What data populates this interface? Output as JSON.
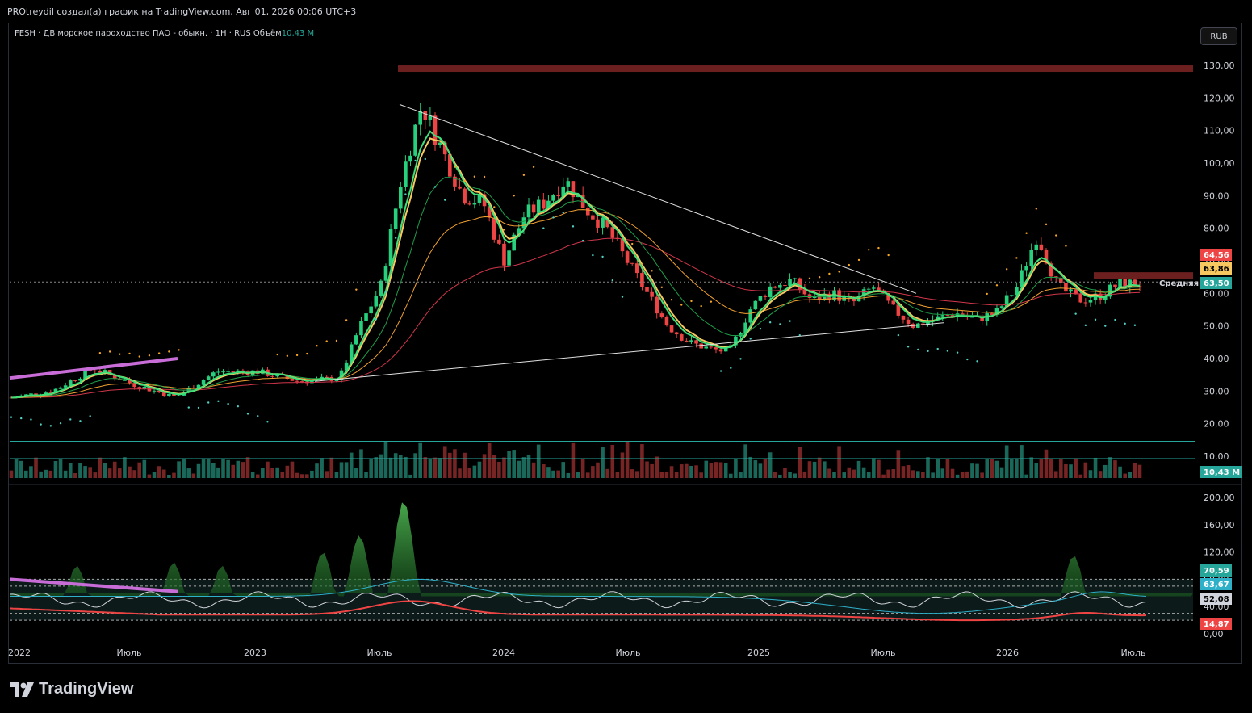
{
  "header": {
    "text": "PROtreydil создал(а) график на TradingView.com, Авг 01, 2026 00:06 UTC+3"
  },
  "legend": {
    "symbol": "FESH",
    "separator": "·",
    "name": "ДВ морское пароходство ПАО - обыкн.",
    "interval": "1H",
    "exchange": "RUS",
    "volume_label": "Объём",
    "volume_value": "10,43 M"
  },
  "currency_button": "RUB",
  "brand": "TradingView",
  "colors": {
    "up": "#26d07c",
    "down": "#ef4444",
    "accent_teal": "#26a69a",
    "resistance": "#6b1f1f",
    "trend": "#e0e0e0",
    "purple": "#c86dd7"
  },
  "chart_data": [
    {
      "type": "candlestick",
      "price_axis": {
        "min": 0,
        "max": 130,
        "ticks": [
          "130,00",
          "120,00",
          "110,00",
          "100,00",
          "90,00",
          "80,00",
          "70,00",
          "60,00",
          "50,00",
          "40,00",
          "30,00",
          "20,00",
          "10,00"
        ]
      },
      "time_axis": {
        "labels": [
          "2022",
          "Июль",
          "2023",
          "Июль",
          "2024",
          "Июль",
          "2025",
          "Июль",
          "2026",
          "Июль"
        ]
      },
      "series": [
        {
          "name": "price",
          "x": [
            "2022-01",
            "2022-03",
            "2022-05",
            "2022-07",
            "2022-09",
            "2022-11",
            "2023-01",
            "2023-03",
            "2023-05",
            "2023-06",
            "2023-07",
            "2023-08",
            "2023-09",
            "2023-10",
            "2023-11",
            "2023-12",
            "2024-01",
            "2024-02",
            "2024-03",
            "2024-04",
            "2024-05",
            "2024-06",
            "2024-07",
            "2024-08",
            "2024-09",
            "2024-10",
            "2024-11",
            "2024-12",
            "2025-01",
            "2025-02",
            "2025-03",
            "2025-04",
            "2025-05",
            "2025-06",
            "2025-07",
            "2025-08",
            "2025-09",
            "2025-10",
            "2025-11",
            "2025-12",
            "2026-01",
            "2026-02",
            "2026-03",
            "2026-04",
            "2026-05",
            "2026-06",
            "2026-07"
          ],
          "y": [
            28,
            30,
            37,
            32,
            28,
            36,
            36,
            33,
            34,
            50,
            62,
            95,
            118,
            104,
            90,
            88,
            70,
            84,
            88,
            95,
            86,
            80,
            70,
            60,
            50,
            45,
            43,
            42,
            55,
            62,
            64,
            58,
            60,
            57,
            62,
            55,
            50,
            52,
            54,
            52,
            54,
            62,
            78,
            62,
            58,
            59,
            63
          ]
        },
        {
          "name": "resistance",
          "y": 129
        },
        {
          "name": "zone",
          "y": [
            64.5,
            66.5
          ]
        },
        {
          "name": "ma_red",
          "y": 50
        },
        {
          "name": "ma_orange",
          "y": 57
        },
        {
          "name": "ma_green",
          "y": 60
        },
        {
          "name": "dashed_level",
          "y": 63.5
        }
      ],
      "price_badges": [
        {
          "value": "64,56",
          "color": "#ef4444"
        },
        {
          "value": "63,86",
          "color": "#f6c85f"
        },
        {
          "value": "63,50",
          "color": "#26a69a",
          "label": "Средняя"
        }
      ],
      "volume": {
        "value": "10,43 M",
        "levels": [
          14,
          10
        ]
      }
    },
    {
      "type": "line",
      "y_axis": {
        "min": 0,
        "max": 200,
        "ticks": [
          "200,00",
          "160,00",
          "120,00",
          "80,00",
          "40,00",
          "0,00"
        ]
      },
      "badges": [
        {
          "value": "70,59",
          "color": "#26a69a"
        },
        {
          "value": "63,67",
          "color": "#2eb0c9"
        },
        {
          "value": "52,08",
          "color": "#d1d4dc"
        },
        {
          "value": "14,87",
          "color": "#ef4444"
        }
      ],
      "levels": [
        80,
        70,
        30,
        20
      ]
    }
  ]
}
